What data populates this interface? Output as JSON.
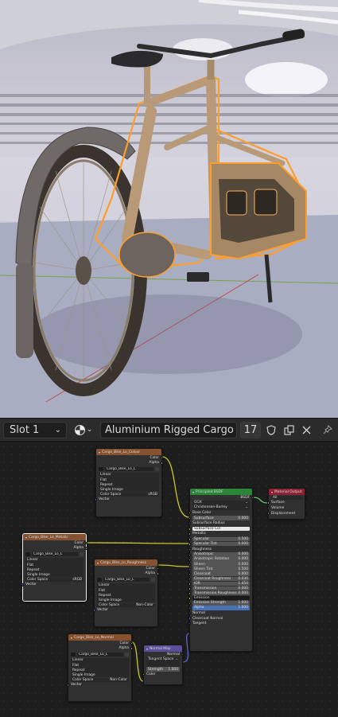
{
  "header": {
    "slot_label": "Slot 1",
    "material_name": "Aluminium Rigged Cargo Bike",
    "user_count": "17"
  },
  "icons": {
    "slot_dropdown": "chevron-down-icon",
    "material_browse": "material-sphere-icon",
    "fake_user": "shield-icon",
    "duplicate": "duplicate-icon",
    "unlink": "close-icon",
    "pin": "pin-icon"
  },
  "colors": {
    "selection_outline": "#ff9d2a",
    "texture_node_header": "#86512f",
    "shader_node_header": "#2b8437",
    "output_node_header": "#8c2233",
    "vector_node_header": "#5b4d9a"
  },
  "nodes": {
    "tex1": {
      "title": "Cargo_Bike_Lo_Colour",
      "out_color": "Color",
      "out_alpha": "Alpha",
      "image": "Cargo_Bike_Lo_L",
      "interp": "Linear",
      "proj": "Flat",
      "ext": "Repeat",
      "src": "Single Image",
      "cs_label": "Color Space",
      "cs_value": "sRGB",
      "vector": "Vector"
    },
    "tex2": {
      "title": "Cargo_Bike_Lo_Metalic",
      "out_color": "Color",
      "out_alpha": "Alpha",
      "image": "Cargo_Bike_Lo_L",
      "interp": "Linear",
      "proj": "Flat",
      "ext": "Repeat",
      "src": "Single Image",
      "cs_label": "Color Space",
      "cs_value": "sRGB",
      "vector": "Vector"
    },
    "tex3": {
      "title": "Cargo_Bike_Lo_Roughness",
      "out_color": "Color",
      "out_alpha": "Alpha",
      "image": "Cargo_Bike_Lo_L",
      "interp": "Linear",
      "proj": "Flat",
      "ext": "Repeat",
      "src": "Single Image",
      "cs_label": "Color Space",
      "cs_value": "Non-Color",
      "vector": "Vector"
    },
    "tex4": {
      "title": "Cargo_Bike_Lo_Normal",
      "out_color": "Color",
      "out_alpha": "Alpha",
      "image": "Cargo_Bike_Lo_L",
      "interp": "Linear",
      "proj": "Flat",
      "ext": "Repeat",
      "src": "Single Image",
      "cs_label": "Color Space",
      "cs_value": "Non-Color",
      "vector": "Vector"
    },
    "bsdf": {
      "title": "Principled BSDF",
      "out": "BSDF",
      "dist": "GGX",
      "sss": "Christensen-Burley",
      "rows": [
        {
          "label": "Base Color",
          "value": ""
        },
        {
          "label": "Subsurface",
          "value": "0.000"
        },
        {
          "label": "Subsurface Radius",
          "value": ""
        },
        {
          "label": "Subsurface Col",
          "value": ""
        },
        {
          "label": "Metallic",
          "value": ""
        },
        {
          "label": "Specular",
          "value": "0.500"
        },
        {
          "label": "Specular Tint",
          "value": "0.000"
        },
        {
          "label": "Roughness",
          "value": ""
        },
        {
          "label": "Anisotropic",
          "value": "0.000"
        },
        {
          "label": "Anisotropic Rotation",
          "value": "0.000"
        },
        {
          "label": "Sheen",
          "value": "0.000"
        },
        {
          "label": "Sheen Tint",
          "value": "0.500"
        },
        {
          "label": "Clearcoat",
          "value": "0.000"
        },
        {
          "label": "Clearcoat Roughness",
          "value": "0.030"
        },
        {
          "label": "IOR",
          "value": "1.450"
        },
        {
          "label": "Transmission",
          "value": "0.000"
        },
        {
          "label": "Transmission Roughness",
          "value": "0.000"
        },
        {
          "label": "Emission",
          "value": ""
        },
        {
          "label": "Emission Strength",
          "value": "1.000"
        },
        {
          "label": "Alpha",
          "value": "1.000"
        },
        {
          "label": "Normal",
          "value": ""
        },
        {
          "label": "Clearcoat Normal",
          "value": ""
        },
        {
          "label": "Tangent",
          "value": ""
        }
      ]
    },
    "output": {
      "title": "Material Output",
      "target": "All",
      "surface": "Surface",
      "volume": "Volume",
      "disp": "Displacement"
    },
    "normal_map": {
      "title": "Normal Map",
      "out": "Normal",
      "space": "Tangent Space",
      "strength_label": "Strength",
      "strength_value": "1.000",
      "in_color": "Color"
    }
  }
}
